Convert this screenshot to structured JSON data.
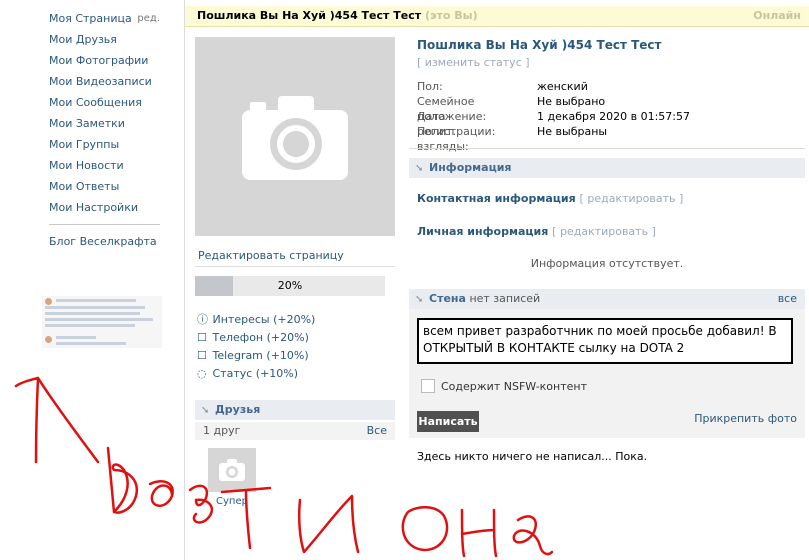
{
  "menu": {
    "items": [
      "Моя Страница",
      "Мои Друзья",
      "Мои Фотографии",
      "Мои Видеозаписи",
      "Мои Сообщения",
      "Мои Заметки",
      "Мои Группы",
      "Мои Новости",
      "Мои Ответы",
      "Мои Настройки"
    ],
    "edit_label": "ред.",
    "blog": "Блог Веселкрафта"
  },
  "topbar": {
    "name": "Пошлика Вы На Хуй )454 Тест Тест",
    "you": "(это Вы)",
    "online": "Онлайн"
  },
  "profile": {
    "name": "Пошлика Вы На Хуй )454 Тест Тест",
    "status_link": "[ изменить статус ]",
    "fields": [
      {
        "label": "Пол:",
        "value": "женский"
      },
      {
        "label": "Семейное положение:",
        "value": "Не выбрано"
      },
      {
        "label": "Дата регистрации:",
        "value": "1 декабря 2020 в 01:57:57"
      },
      {
        "label": "Полит. взгляды:",
        "value": "Не выбраны"
      }
    ]
  },
  "left": {
    "edit_page": "Редактировать страницу",
    "progress": {
      "value": 0.2,
      "label": "20%"
    },
    "tips": [
      {
        "icon": "interests-icon",
        "text": "Интересы (+20%)"
      },
      {
        "icon": "phone-icon",
        "text": "Телефон (+20%)"
      },
      {
        "icon": "telegram-icon",
        "text": "Telegram (+10%)"
      },
      {
        "icon": "status-icon",
        "text": "Статус (+10%)"
      }
    ],
    "friends": {
      "title": "Друзья",
      "count": "1 друг",
      "all": "Все",
      "friend_name": "Супер"
    }
  },
  "info": {
    "title": "Информация",
    "contact": "Контактная информация",
    "personal": "Личная информация",
    "edit": "[ редактировать ]",
    "empty": "Информация отсутствует."
  },
  "wall": {
    "title": "Стена",
    "count": "нет записей",
    "all": "все",
    "post_text": "всем привет разработчник по моей просьбе добавил! В ОТКРЫТЫЙ В КОНТАКТЕ сылку на DOTA 2",
    "nsfw": "Содержит NSFW-контент",
    "send": "Написать",
    "attach": "Прикрепить фото",
    "empty": "Здесь никто ничего не написал... Пока."
  },
  "colors": {
    "link": "#2b587a",
    "header_bg": "#e9edf1",
    "scribble": "#e01010"
  }
}
